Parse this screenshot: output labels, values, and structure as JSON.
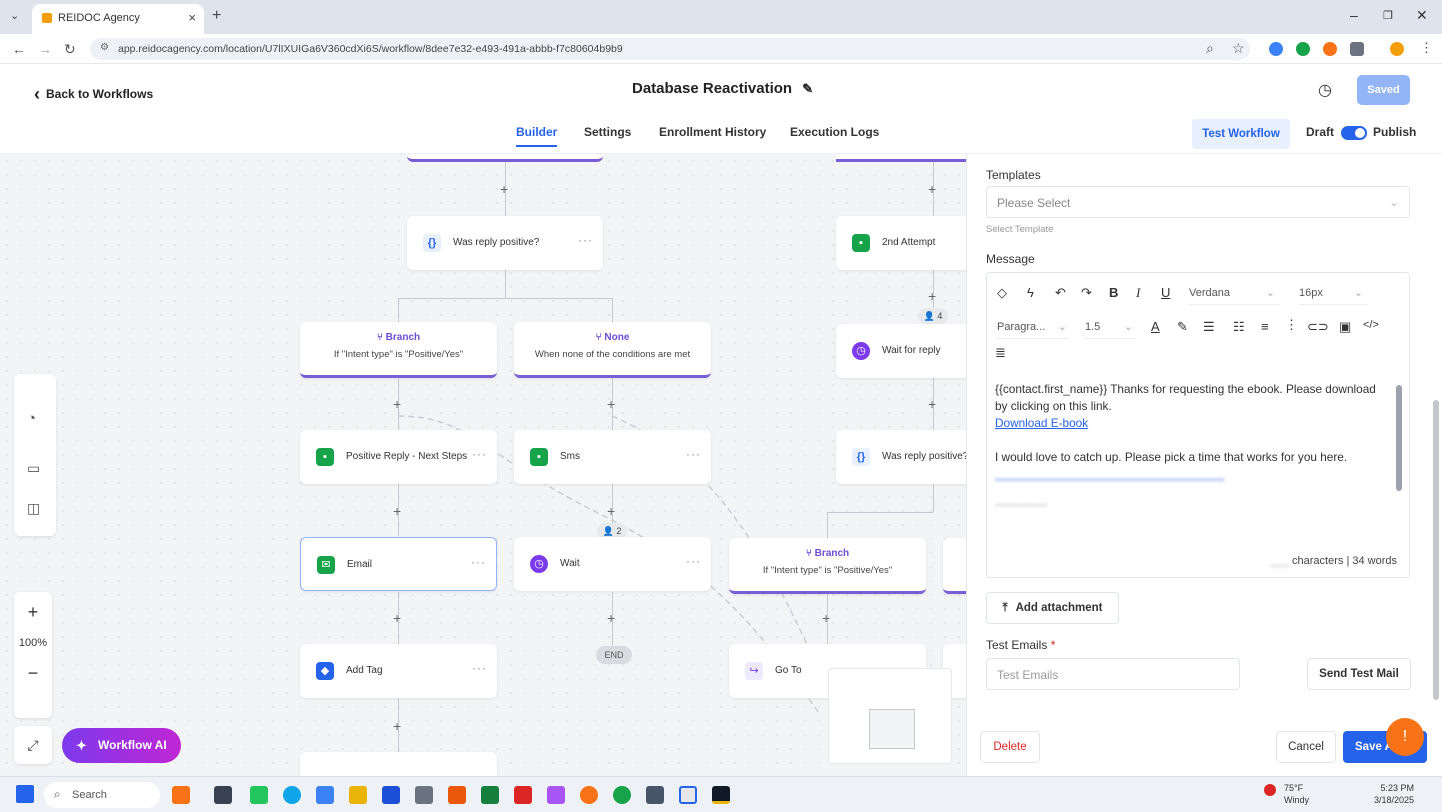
{
  "browser": {
    "tab_title": "REIDOC Agency",
    "url": "app.reidocagency.com/location/U7lIXUIGa6V360cdXi6S/workflow/8dee7e32-e493-491a-abbb-f7c80604b9b9"
  },
  "header": {
    "back_label": "Back to Workflows",
    "workflow_title": "Database Reactivation",
    "saved_label": "Saved",
    "tabs": [
      "Builder",
      "Settings",
      "Enrollment History",
      "Execution Logs"
    ],
    "active_tab": "Builder",
    "test_workflow_label": "Test Workflow",
    "draft_label": "Draft",
    "publish_label": "Publish"
  },
  "canvas": {
    "nodes": {
      "was_reply_positive": "Was reply positive?",
      "second_attempt": "2nd Attempt",
      "branch1_title": "Branch",
      "branch1_sub": "If \"Intent type\" is \"Positive/Yes\"",
      "none_title": "None",
      "none_sub": "When none of the conditions are met",
      "wait_for_reply": "Wait for reply",
      "positive_reply": "Positive Reply - Next Steps",
      "sms": "Sms",
      "was_reply_positive2": "Was reply positive?",
      "email": "Email",
      "wait": "Wait",
      "branch2_title": "Branch",
      "branch2_sub": "If \"Intent type\" is \"Positive/Yes\"",
      "add_tag": "Add Tag",
      "go_to": "Go To",
      "end": "END"
    },
    "counters": {
      "c4": "4",
      "c2": "2"
    },
    "zoom": "100%",
    "workflow_ai_label": "Workflow AI"
  },
  "panel": {
    "templates_label": "Templates",
    "templates_placeholder": "Please Select",
    "templates_hint": "Select Template",
    "message_label": "Message",
    "font_name": "Verdana",
    "font_size": "16px",
    "paragraph": "Paragra...",
    "line_height": "1.5",
    "message_line1": "{{contact.first_name}} Thanks for requesting the ebook. Please download by clicking on this link.",
    "download_link": "Download E-book",
    "message_line2": "I would love to catch up. Please pick a time that works for you here.",
    "count_suffix": "characters | 34 words",
    "add_attachment": "Add attachment",
    "test_emails_label": "Test Emails",
    "required_mark": "*",
    "test_emails_placeholder": "Test Emails",
    "send_test_mail": "Send Test Mail",
    "delete_label": "Delete",
    "cancel_label": "Cancel",
    "save_label": "Save A"
  },
  "taskbar": {
    "search_label": "Search",
    "weather_temp": "75°F",
    "weather_desc": "Windy",
    "time": "5:23 PM",
    "date": "3/18/2025"
  }
}
